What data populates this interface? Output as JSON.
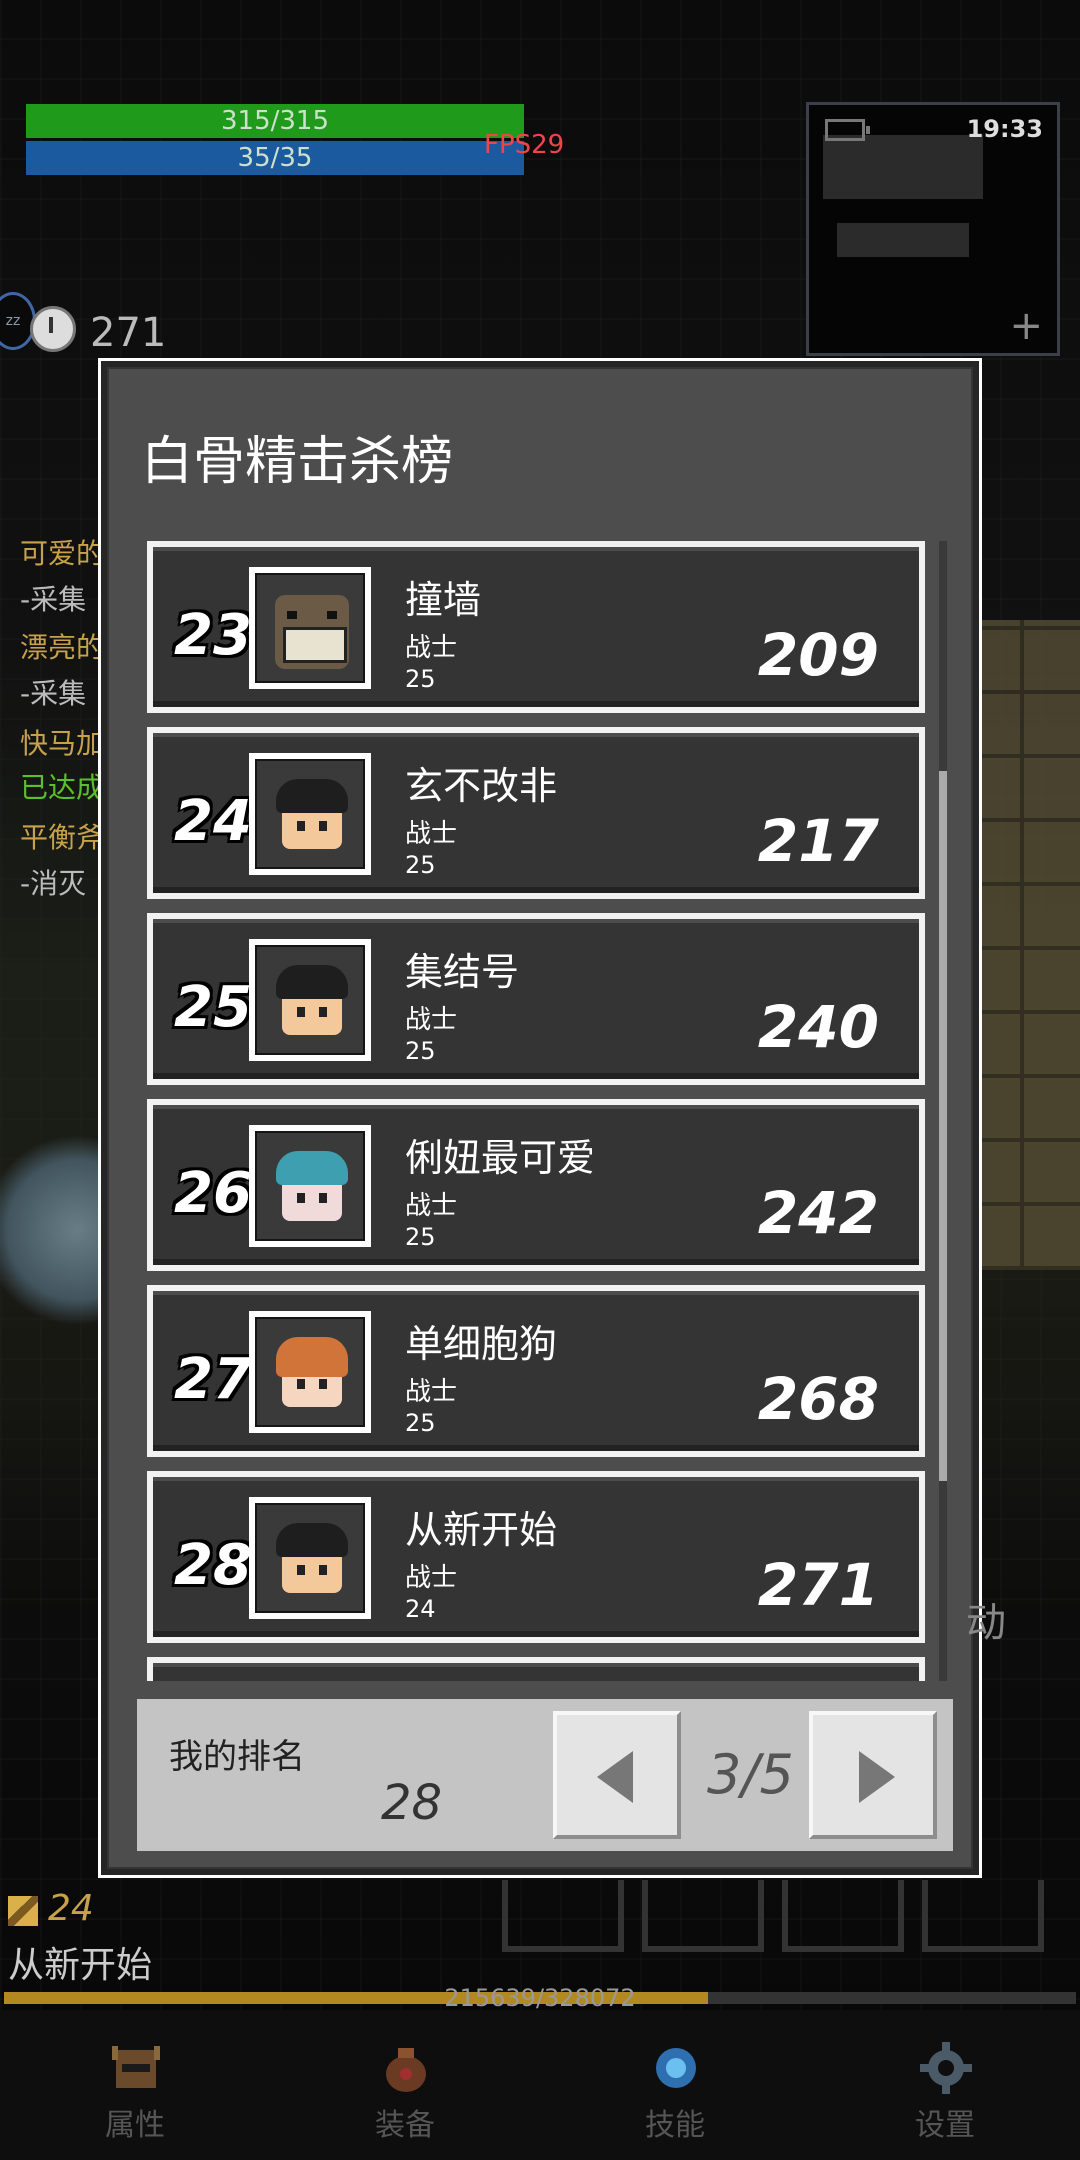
{
  "hud": {
    "hp": "315/315",
    "mp": "35/35",
    "fps": "FPS29",
    "clock": "19:33",
    "turns": "271",
    "hp_fill": 1.0,
    "mp_fill": 1.0
  },
  "quests": [
    {
      "line1": "可爱的",
      "line2": "-采集"
    },
    {
      "line1": "漂亮的",
      "line2": "-采集"
    },
    {
      "line1": "快马加",
      "line2": "已达成"
    },
    {
      "line1": "平衡斧",
      "line2": "-消灭"
    }
  ],
  "dialog": {
    "title": "白骨精击杀榜",
    "entries": [
      {
        "rank": "23",
        "name": "撞墙",
        "class": "战士",
        "level": "25",
        "score": "209",
        "avatar": "monster-avatar-icon"
      },
      {
        "rank": "24",
        "name": "玄不改非",
        "class": "战士",
        "level": "25",
        "score": "217",
        "avatar": "warrior-avatar-icon"
      },
      {
        "rank": "25",
        "name": "集结号",
        "class": "战士",
        "level": "25",
        "score": "240",
        "avatar": "warrior-avatar-icon"
      },
      {
        "rank": "26",
        "name": "俐妞最可爱",
        "class": "战士",
        "level": "25",
        "score": "242",
        "avatar": "blue-hair-avatar-icon"
      },
      {
        "rank": "27",
        "name": "单细胞狗",
        "class": "战士",
        "level": "25",
        "score": "268",
        "avatar": "orange-hair-avatar-icon"
      },
      {
        "rank": "28",
        "name": "从新开始",
        "class": "战士",
        "level": "24",
        "score": "271",
        "avatar": "warrior-avatar-icon"
      }
    ],
    "my_rank_label": "我的排名",
    "my_rank": "28",
    "page": "3/5"
  },
  "hero": {
    "level": "24",
    "name": "从新开始",
    "xp": "215639/328072",
    "xp_fraction": 0.657
  },
  "auto_button": "动",
  "nav": [
    {
      "label": "属性",
      "icon": "helmet-icon"
    },
    {
      "label": "装备",
      "icon": "bag-icon"
    },
    {
      "label": "技能",
      "icon": "skill-orb-icon"
    },
    {
      "label": "设置",
      "icon": "gear-icon"
    }
  ],
  "colors": {
    "hp": "#1f9a1a",
    "mp": "#1c5aa0",
    "fps": "#f0444b",
    "xp": "#b28820"
  }
}
